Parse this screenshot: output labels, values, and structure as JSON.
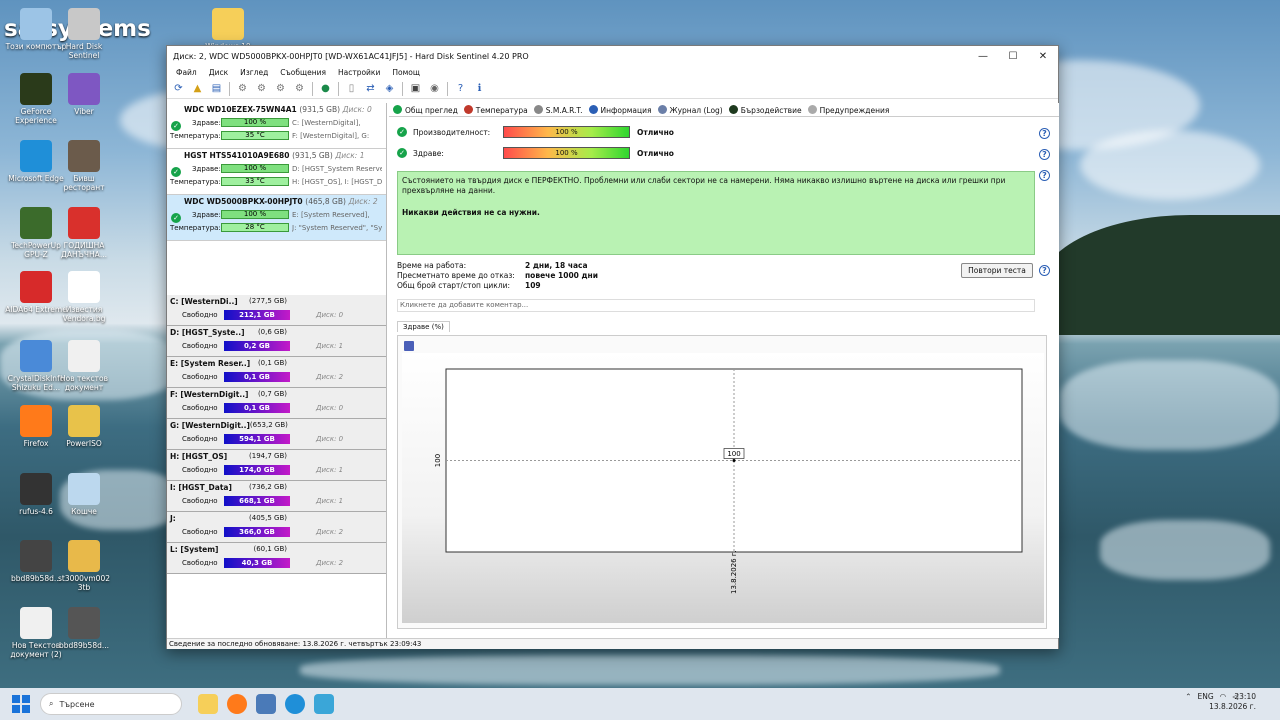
{
  "desktop": {
    "brand": "satsystems",
    "icons": [
      {
        "label": "Този компютър",
        "color": "#9cc4e6"
      },
      {
        "label": "Hard Disk Sentinel",
        "color": "#c8c8c8"
      },
      {
        "label": "Windows 10",
        "color": "#f6cf59"
      },
      {
        "label": "GeForce Experience",
        "color": "#2a3a1a"
      },
      {
        "label": "Viber",
        "color": "#7e57c2"
      },
      {
        "label": "Microsoft Edge",
        "color": "#1f8fd8"
      },
      {
        "label": "Бивш ресторант",
        "color": "#6b5b4b"
      },
      {
        "label": "TechPowerUp GPU-Z",
        "color": "#3b6b2b"
      },
      {
        "label": "ГОДИШНА ДАНЪЧНА...",
        "color": "#d9302c"
      },
      {
        "label": "AIDA64 Extreme",
        "color": "#d72a2a"
      },
      {
        "label": "Известия Vendora.bg",
        "color": "#ffffff"
      },
      {
        "label": "CrystalDiskInfo Shizuku Ed...",
        "color": "#4a8ad8"
      },
      {
        "label": "Нов текстов документ",
        "color": "#f0f0f0"
      },
      {
        "label": "Firefox",
        "color": "#ff7a1a"
      },
      {
        "label": "PowerISO",
        "color": "#e8c24a"
      },
      {
        "label": "rufus-4.6",
        "color": "#333333"
      },
      {
        "label": "Кошче",
        "color": "#bcd8ee"
      },
      {
        "label": "bbd89b58d...",
        "color": "#444444"
      },
      {
        "label": "st3000vm002 3tb",
        "color": "#e8b94a"
      },
      {
        "label": "Нов Текстов документ (2)",
        "color": "#f0f0f0"
      },
      {
        "label": "bbd89b58d...",
        "color": "#555555"
      }
    ]
  },
  "window": {
    "title": "Диск: 2, WDC WD5000BPKX-00HPJT0 [WD-WX61AC41JFJ5]  -  Hard Disk Sentinel 4.20 PRO",
    "menu": [
      "Файл",
      "Диск",
      "Изглед",
      "Съобщения",
      "Настройки",
      "Помощ"
    ]
  },
  "disks": [
    {
      "name": "WDC WD10EZEX-75WN4A1",
      "size": "(931,5 GB)",
      "num": "Диск: 0",
      "health_label": "Здраве:",
      "health": "100 %",
      "temp_label": "Температура:",
      "temp": "35 °C",
      "vols1": "C: [WesternDigital],",
      "vols2": "F: [WesternDigital], G:",
      "selected": false
    },
    {
      "name": "HGST HTS541010A9E680",
      "size": "(931,5 GB)",
      "num": "Диск: 1",
      "health_label": "Здраве:",
      "health": "100 %",
      "temp_label": "Температура:",
      "temp": "33 °C",
      "vols1": "D: [HGST_System Reserve",
      "vols2": "H: [HGST_OS], I: [HGST_D",
      "selected": false
    },
    {
      "name": "WDC WD5000BPKX-00HPJT0",
      "size": "(465,8 GB)",
      "num": "Диск: 2",
      "health_label": "Здраве:",
      "health": "100 %",
      "temp_label": "Температура:",
      "temp": "28 °C",
      "vols1": "E: [System Reserved],",
      "vols2": "J: \"System Reserved\", \"Sy",
      "selected": true
    }
  ],
  "volumes": [
    {
      "name": "C: [WesternDi..]",
      "size": "(277,5 GB)",
      "free_label": "Свободно",
      "free": "212,1 GB",
      "disk": "Диск: 0"
    },
    {
      "name": "D: [HGST_Syste..]",
      "size": "(0,6 GB)",
      "free_label": "Свободно",
      "free": "0,2 GB",
      "disk": "Диск: 1"
    },
    {
      "name": "E: [System Reser..]",
      "size": "(0,1 GB)",
      "free_label": "Свободно",
      "free": "0,1 GB",
      "disk": "Диск: 2"
    },
    {
      "name": "F: [WesternDigit..]",
      "size": "(0,7 GB)",
      "free_label": "Свободно",
      "free": "0,1 GB",
      "disk": "Диск: 0"
    },
    {
      "name": "G: [WesternDigit..]",
      "size": "(653,2 GB)",
      "free_label": "Свободно",
      "free": "594,1 GB",
      "disk": "Диск: 0"
    },
    {
      "name": "H: [HGST_OS]",
      "size": "(194,7 GB)",
      "free_label": "Свободно",
      "free": "174,0 GB",
      "disk": "Диск: 1"
    },
    {
      "name": "I: [HGST_Data]",
      "size": "(736,2 GB)",
      "free_label": "Свободно",
      "free": "668,1 GB",
      "disk": "Диск: 1"
    },
    {
      "name": "J:",
      "size": "(405,5 GB)",
      "free_label": "Свободно",
      "free": "366,0 GB",
      "disk": "Диск: 2"
    },
    {
      "name": "L: [System]",
      "size": "(60,1 GB)",
      "free_label": "Свободно",
      "free": "40,3 GB",
      "disk": "Диск: 2"
    }
  ],
  "tabs": [
    {
      "label": "Общ преглед",
      "color": "#16a34a"
    },
    {
      "label": "Температура",
      "color": "#c0392b"
    },
    {
      "label": "S.M.A.R.T.",
      "color": "#888888"
    },
    {
      "label": "Информация",
      "color": "#2b5fb5"
    },
    {
      "label": "Журнал (Log)",
      "color": "#6b7fa8"
    },
    {
      "label": "Бързодействие",
      "color": "#1e3a1e"
    },
    {
      "label": "Предупреждения",
      "color": "#aaaaaa"
    }
  ],
  "overview": {
    "perf_label": "Производителност:",
    "perf_value": "100 %",
    "perf_rating": "Отлично",
    "health_label": "Здраве:",
    "health_value": "100 %",
    "health_rating": "Отлично",
    "message": "Състоянието на твърдия диск е ПЕРФЕКТНО. Проблемни или слаби сектори не са намерени. Няма никакво излишно въртене на диска или грешки при прехвърляне на данни.",
    "action": "Никакви действия не са нужни.",
    "uptime_label": "Време на работа:",
    "uptime": "2 дни, 18 часа",
    "lifetime_label": "Пресметнато време до отказ:",
    "lifetime": "повече 1000 дни",
    "cycles_label": "Общ брой старт/стоп цикли:",
    "cycles": "109",
    "retest": "Повтори теста",
    "comment": "Кликнете да добавите коментар...",
    "graph_tab": "Здраве (%)"
  },
  "chart_data": {
    "type": "line",
    "title": "",
    "xlabel": "",
    "ylabel": "",
    "categories": [
      "13.8.2026 г."
    ],
    "series": [
      {
        "values": [
          100
        ]
      }
    ],
    "point_label": "100",
    "y_tick": "100"
  },
  "status": "Сведение за последно обновяване: 13.8.2026 г. четвъртък 23:09:43",
  "taskbar": {
    "search": "Търсене",
    "lang": "ENG",
    "time": "23:10",
    "date": "13.8.2026 г."
  }
}
